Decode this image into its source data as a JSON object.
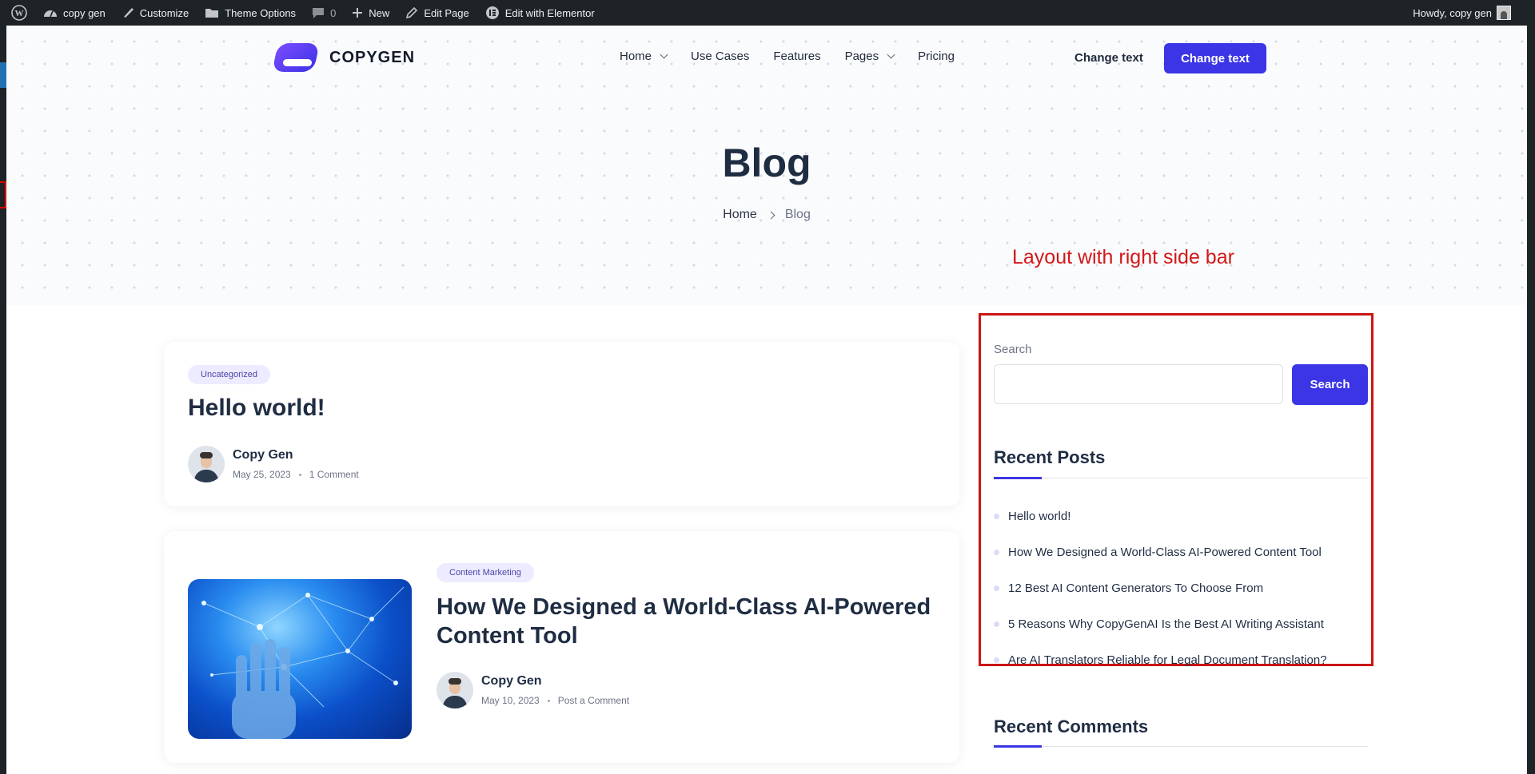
{
  "admin_bar": {
    "site_name": "copy gen",
    "customize": "Customize",
    "theme_options": "Theme Options",
    "comments_count": "0",
    "new": "New",
    "edit_page": "Edit Page",
    "edit_elementor": "Edit with Elementor",
    "greeting": "Howdy, copy gen"
  },
  "header": {
    "logo_text": "COPYGEN",
    "nav": [
      "Home",
      "Use Cases",
      "Features",
      "Pages",
      "Pricing"
    ],
    "change_link": "Change text",
    "change_button": "Change text"
  },
  "hero": {
    "title": "Blog",
    "breadcrumb": [
      "Home",
      "Blog"
    ]
  },
  "annotation": "Layout with right side bar",
  "posts": [
    {
      "category": "Uncategorized",
      "title": "Hello world!",
      "author": "Copy Gen",
      "date": "May 25, 2023",
      "comments": "1 Comment"
    },
    {
      "category": "Content Marketing",
      "title_line1": "How We Designed a World-Class AI-Powered",
      "title_line2": "Content Tool",
      "author": "Copy Gen",
      "date": "May 10, 2023",
      "comments": "Post a Comment"
    }
  ],
  "sidebar": {
    "search_label": "Search",
    "search_value": "",
    "search_button": "Search",
    "recent_posts_title": "Recent Posts",
    "recent_posts": [
      "Hello world!",
      "How We Designed a World-Class AI-Powered Content Tool",
      "12 Best AI Content Generators To Choose From",
      "5 Reasons Why CopyGenAI Is the Best AI Writing Assistant",
      "Are AI Translators Reliable for Legal Document Translation?"
    ],
    "recent_comments_title": "Recent Comments"
  },
  "colors": {
    "accent": "#3b35e5",
    "annotation_red": "#cc1414",
    "admin_bar": "#1d2327"
  }
}
